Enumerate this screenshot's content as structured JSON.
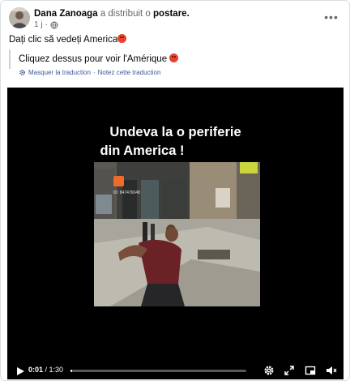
{
  "post": {
    "author": "Dana Zanoaga",
    "action_text": "a distribuit o",
    "target": "postare.",
    "timestamp": "1 j",
    "separator": "·",
    "audience_icon": "globe-icon",
    "more_icon": "more-options-icon",
    "text": "Dați clic să vedeți America"
  },
  "translation": {
    "text": "Cliquez dessus pour voir l'Amérique",
    "hide_link": "Masquer la traduction",
    "link_separator": "·",
    "rate_link": "Notez cette traduction"
  },
  "video": {
    "caption_line1": "Undeva la o periferie",
    "caption_line2": "din America !",
    "clip_id_text": "ID: 847476048",
    "current_time": "0:01",
    "time_separator": " / ",
    "total_time": "1:30",
    "progress_fraction": 0.011,
    "controls": [
      "play-icon",
      "settings-icon",
      "fullscreen-icon",
      "picture-in-picture-icon",
      "volume-muted-icon"
    ]
  },
  "colors": {
    "link": "#385898",
    "secondary_text": "#65676b",
    "emoji": "#e8412c",
    "video_background": "#000000"
  }
}
